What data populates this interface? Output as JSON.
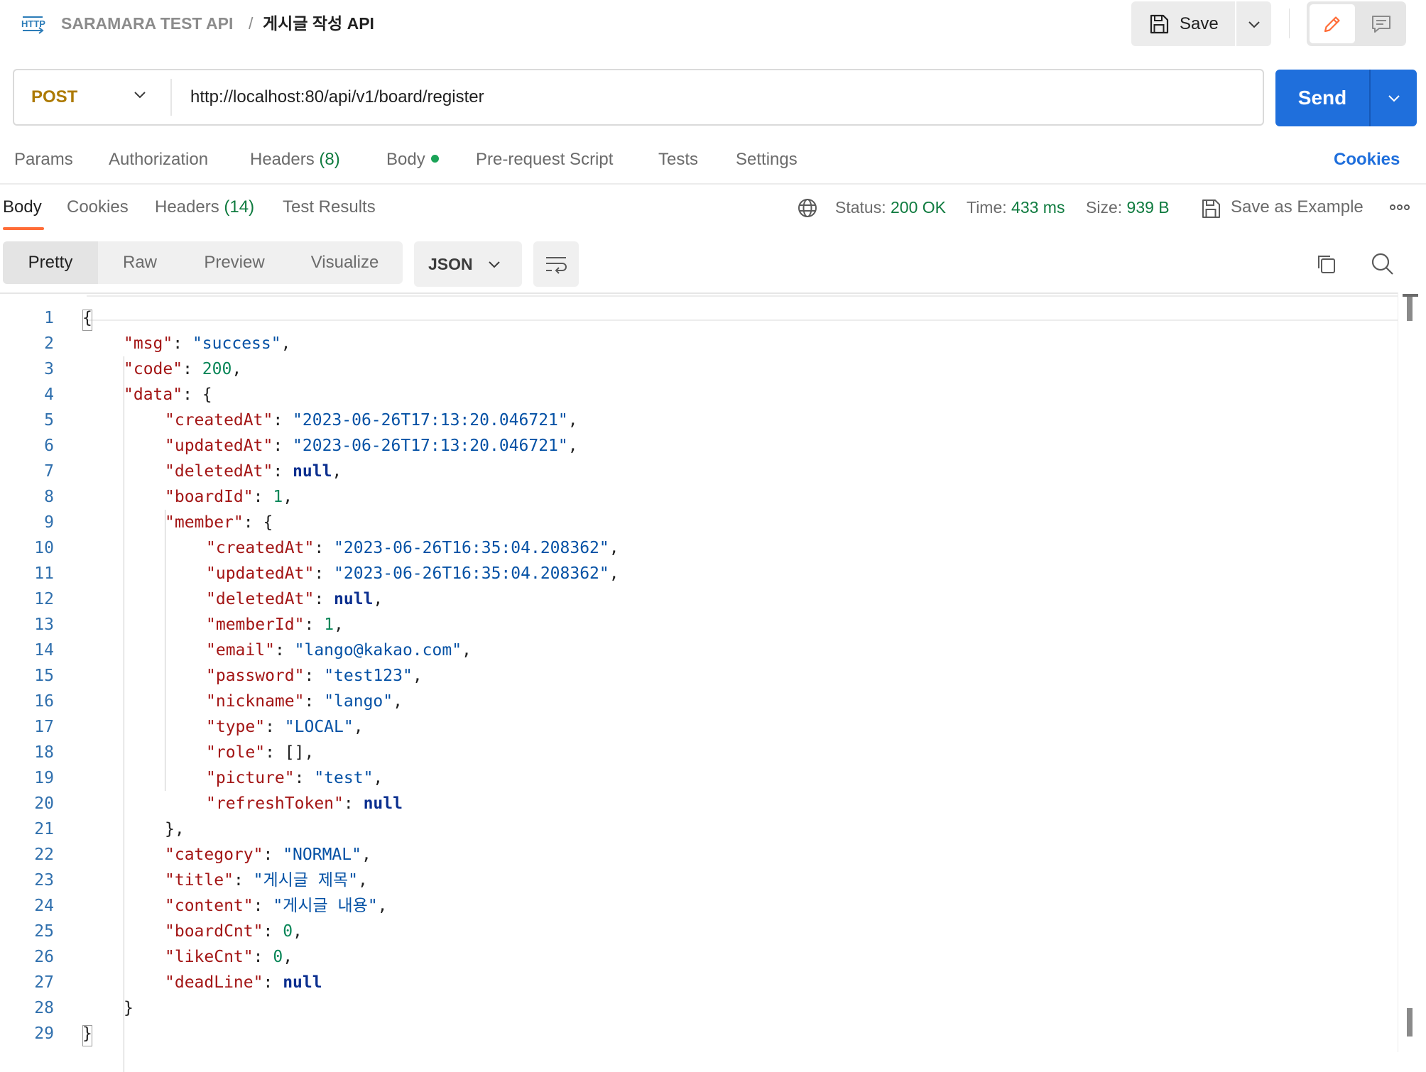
{
  "breadcrumb": {
    "collection": "SARAMARA TEST API",
    "separator": "/",
    "request": "게시글 작성 API"
  },
  "toolbar": {
    "save_label": "Save",
    "icons": {
      "http": "http-icon",
      "save": "save-icon",
      "edit": "pencil-icon",
      "comment": "comment-icon"
    }
  },
  "request": {
    "method": "POST",
    "url": "http://localhost:80/api/v1/board/register",
    "send_label": "Send"
  },
  "request_tabs": {
    "params": "Params",
    "authorization": "Authorization",
    "headers": "Headers",
    "headers_count": "(8)",
    "body": "Body",
    "pre_request": "Pre-request Script",
    "tests": "Tests",
    "settings": "Settings",
    "cookies": "Cookies"
  },
  "response_tabs": {
    "body": "Body",
    "cookies": "Cookies",
    "headers": "Headers",
    "headers_count": "(14)",
    "test_results": "Test Results"
  },
  "response_meta": {
    "status_label": "Status:",
    "status_value": "200 OK",
    "time_label": "Time:",
    "time_value": "433 ms",
    "size_label": "Size:",
    "size_value": "939 B",
    "save_example": "Save as Example"
  },
  "view": {
    "pretty": "Pretty",
    "raw": "Raw",
    "preview": "Preview",
    "visualize": "Visualize",
    "format": "JSON",
    "active": "Pretty"
  },
  "colors": {
    "accent": "#1f6fdc",
    "method": "#ad7a03",
    "status_ok": "#0f7b3f",
    "tab_underline": "#ff6c37",
    "json_key": "#a31515",
    "json_string": "#0451a5",
    "json_number": "#098658",
    "json_null": "#0b2f8f"
  },
  "code_lines": [
    {
      "n": "1",
      "indent": 0,
      "tokens": [
        [
          "p",
          "{"
        ]
      ]
    },
    {
      "n": "2",
      "indent": 1,
      "tokens": [
        [
          "k",
          "\"msg\""
        ],
        [
          "p",
          ": "
        ],
        [
          "s",
          "\"success\""
        ],
        [
          "p",
          ","
        ]
      ]
    },
    {
      "n": "3",
      "indent": 1,
      "tokens": [
        [
          "k",
          "\"code\""
        ],
        [
          "p",
          ": "
        ],
        [
          "n",
          "200"
        ],
        [
          "p",
          ","
        ]
      ]
    },
    {
      "n": "4",
      "indent": 1,
      "tokens": [
        [
          "k",
          "\"data\""
        ],
        [
          "p",
          ": {"
        ]
      ]
    },
    {
      "n": "5",
      "indent": 2,
      "tokens": [
        [
          "k",
          "\"createdAt\""
        ],
        [
          "p",
          ": "
        ],
        [
          "s",
          "\"2023-06-26T17:13:20.046721\""
        ],
        [
          "p",
          ","
        ]
      ]
    },
    {
      "n": "6",
      "indent": 2,
      "tokens": [
        [
          "k",
          "\"updatedAt\""
        ],
        [
          "p",
          ": "
        ],
        [
          "s",
          "\"2023-06-26T17:13:20.046721\""
        ],
        [
          "p",
          ","
        ]
      ]
    },
    {
      "n": "7",
      "indent": 2,
      "tokens": [
        [
          "k",
          "\"deletedAt\""
        ],
        [
          "p",
          ": "
        ],
        [
          "nl",
          "null"
        ],
        [
          "p",
          ","
        ]
      ]
    },
    {
      "n": "8",
      "indent": 2,
      "tokens": [
        [
          "k",
          "\"boardId\""
        ],
        [
          "p",
          ": "
        ],
        [
          "n",
          "1"
        ],
        [
          "p",
          ","
        ]
      ]
    },
    {
      "n": "9",
      "indent": 2,
      "tokens": [
        [
          "k",
          "\"member\""
        ],
        [
          "p",
          ": {"
        ]
      ]
    },
    {
      "n": "10",
      "indent": 3,
      "tokens": [
        [
          "k",
          "\"createdAt\""
        ],
        [
          "p",
          ": "
        ],
        [
          "s",
          "\"2023-06-26T16:35:04.208362\""
        ],
        [
          "p",
          ","
        ]
      ]
    },
    {
      "n": "11",
      "indent": 3,
      "tokens": [
        [
          "k",
          "\"updatedAt\""
        ],
        [
          "p",
          ": "
        ],
        [
          "s",
          "\"2023-06-26T16:35:04.208362\""
        ],
        [
          "p",
          ","
        ]
      ]
    },
    {
      "n": "12",
      "indent": 3,
      "tokens": [
        [
          "k",
          "\"deletedAt\""
        ],
        [
          "p",
          ": "
        ],
        [
          "nl",
          "null"
        ],
        [
          "p",
          ","
        ]
      ]
    },
    {
      "n": "13",
      "indent": 3,
      "tokens": [
        [
          "k",
          "\"memberId\""
        ],
        [
          "p",
          ": "
        ],
        [
          "n",
          "1"
        ],
        [
          "p",
          ","
        ]
      ]
    },
    {
      "n": "14",
      "indent": 3,
      "tokens": [
        [
          "k",
          "\"email\""
        ],
        [
          "p",
          ": "
        ],
        [
          "s",
          "\"lango@kakao.com\""
        ],
        [
          "p",
          ","
        ]
      ]
    },
    {
      "n": "15",
      "indent": 3,
      "tokens": [
        [
          "k",
          "\"password\""
        ],
        [
          "p",
          ": "
        ],
        [
          "s",
          "\"test123\""
        ],
        [
          "p",
          ","
        ]
      ]
    },
    {
      "n": "16",
      "indent": 3,
      "tokens": [
        [
          "k",
          "\"nickname\""
        ],
        [
          "p",
          ": "
        ],
        [
          "s",
          "\"lango\""
        ],
        [
          "p",
          ","
        ]
      ]
    },
    {
      "n": "17",
      "indent": 3,
      "tokens": [
        [
          "k",
          "\"type\""
        ],
        [
          "p",
          ": "
        ],
        [
          "s",
          "\"LOCAL\""
        ],
        [
          "p",
          ","
        ]
      ]
    },
    {
      "n": "18",
      "indent": 3,
      "tokens": [
        [
          "k",
          "\"role\""
        ],
        [
          "p",
          ": [],"
        ]
      ]
    },
    {
      "n": "19",
      "indent": 3,
      "tokens": [
        [
          "k",
          "\"picture\""
        ],
        [
          "p",
          ": "
        ],
        [
          "s",
          "\"test\""
        ],
        [
          "p",
          ","
        ]
      ]
    },
    {
      "n": "20",
      "indent": 3,
      "tokens": [
        [
          "k",
          "\"refreshToken\""
        ],
        [
          "p",
          ": "
        ],
        [
          "nl",
          "null"
        ]
      ]
    },
    {
      "n": "21",
      "indent": 2,
      "tokens": [
        [
          "p",
          "},"
        ]
      ]
    },
    {
      "n": "22",
      "indent": 2,
      "tokens": [
        [
          "k",
          "\"category\""
        ],
        [
          "p",
          ": "
        ],
        [
          "s",
          "\"NORMAL\""
        ],
        [
          "p",
          ","
        ]
      ]
    },
    {
      "n": "23",
      "indent": 2,
      "tokens": [
        [
          "k",
          "\"title\""
        ],
        [
          "p",
          ": "
        ],
        [
          "s",
          "\"게시글 제목\""
        ],
        [
          "p",
          ","
        ]
      ]
    },
    {
      "n": "24",
      "indent": 2,
      "tokens": [
        [
          "k",
          "\"content\""
        ],
        [
          "p",
          ": "
        ],
        [
          "s",
          "\"게시글 내용\""
        ],
        [
          "p",
          ","
        ]
      ]
    },
    {
      "n": "25",
      "indent": 2,
      "tokens": [
        [
          "k",
          "\"boardCnt\""
        ],
        [
          "p",
          ": "
        ],
        [
          "n",
          "0"
        ],
        [
          "p",
          ","
        ]
      ]
    },
    {
      "n": "26",
      "indent": 2,
      "tokens": [
        [
          "k",
          "\"likeCnt\""
        ],
        [
          "p",
          ": "
        ],
        [
          "n",
          "0"
        ],
        [
          "p",
          ","
        ]
      ]
    },
    {
      "n": "27",
      "indent": 2,
      "tokens": [
        [
          "k",
          "\"deadLine\""
        ],
        [
          "p",
          ": "
        ],
        [
          "nl",
          "null"
        ]
      ]
    },
    {
      "n": "28",
      "indent": 1,
      "tokens": [
        [
          "p",
          "}"
        ]
      ]
    },
    {
      "n": "29",
      "indent": 0,
      "tokens": [
        [
          "p",
          "}"
        ]
      ]
    }
  ]
}
